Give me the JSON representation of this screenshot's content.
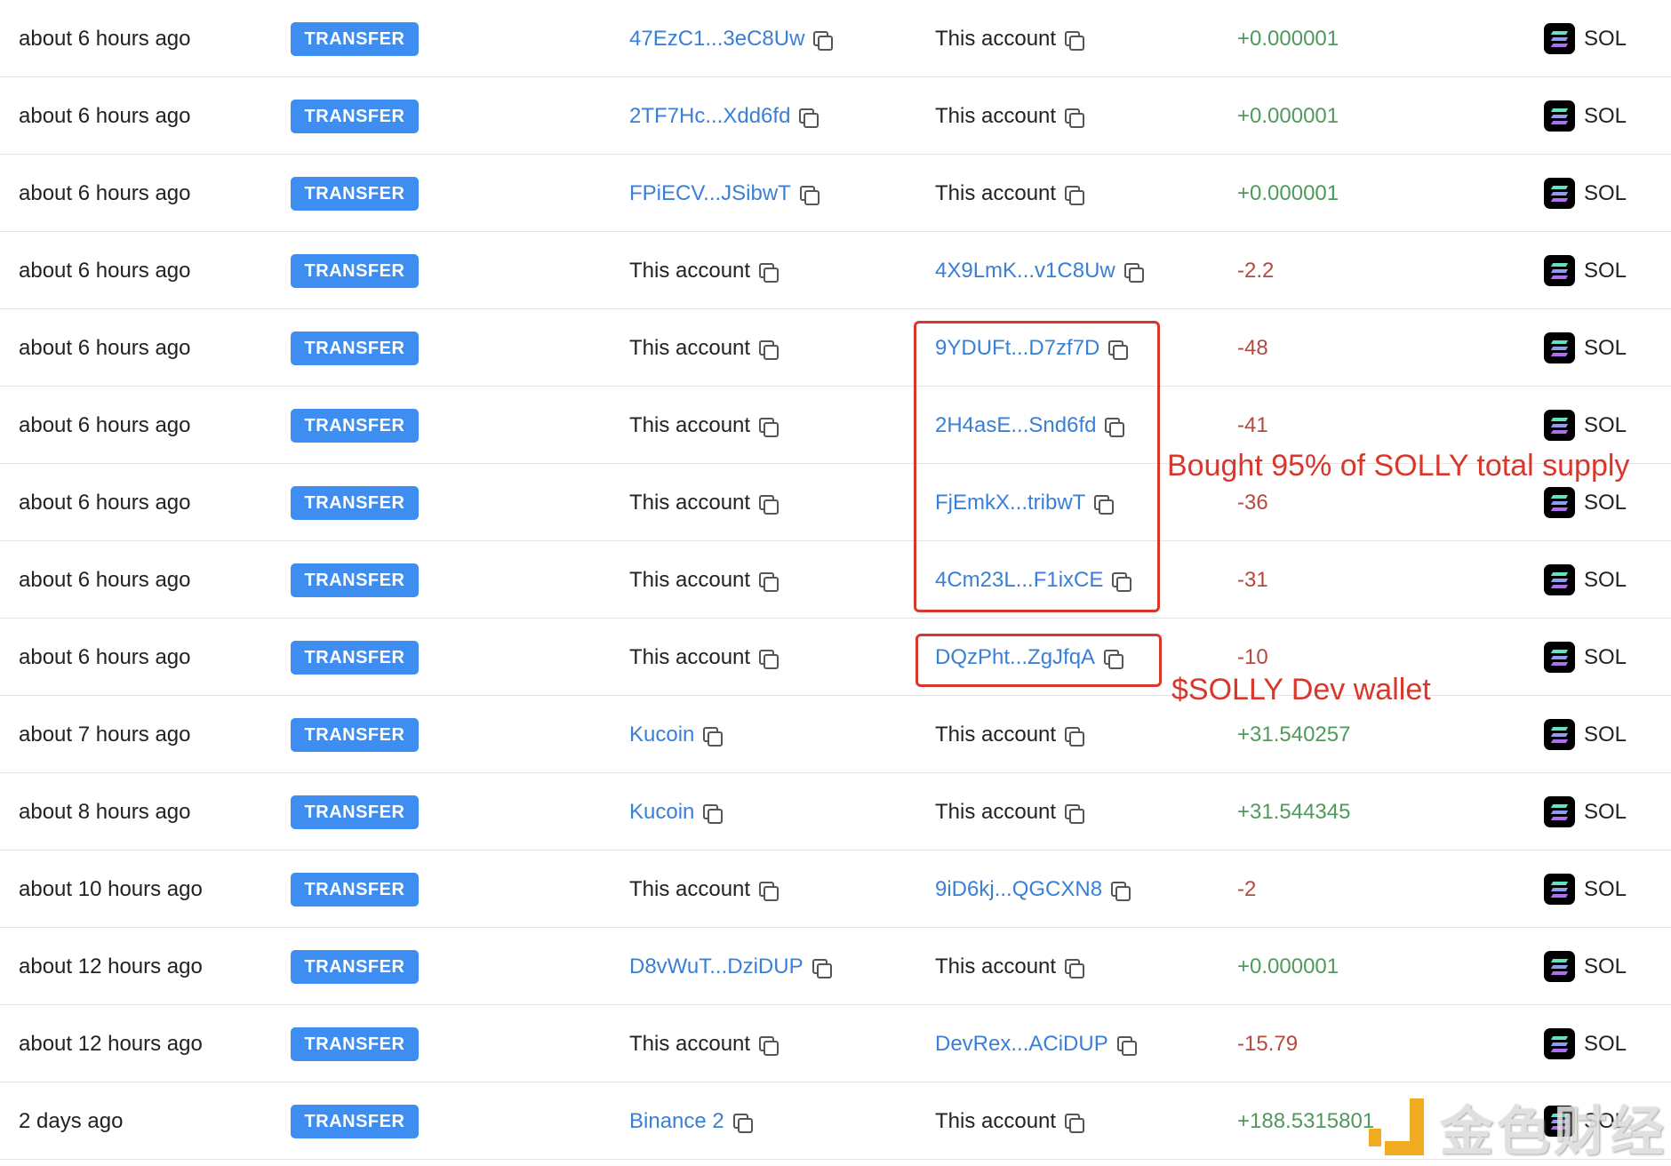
{
  "colors": {
    "badge": "#3d8ef0",
    "link": "#3a7fd6",
    "positive": "#4f9a5b",
    "negative": "#b5483f",
    "annotation": "#d9372b"
  },
  "rows": [
    {
      "time": "about 6 hours ago",
      "type": "TRANSFER",
      "from": "47EzC1...3eC8Uw",
      "from_link": true,
      "to": "This account",
      "to_link": false,
      "amount": "+0.000001",
      "sign": "pos",
      "token": "SOL"
    },
    {
      "time": "about 6 hours ago",
      "type": "TRANSFER",
      "from": "2TF7Hc...Xdd6fd",
      "from_link": true,
      "to": "This account",
      "to_link": false,
      "amount": "+0.000001",
      "sign": "pos",
      "token": "SOL"
    },
    {
      "time": "about 6 hours ago",
      "type": "TRANSFER",
      "from": "FPiECV...JSibwT",
      "from_link": true,
      "to": "This account",
      "to_link": false,
      "amount": "+0.000001",
      "sign": "pos",
      "token": "SOL"
    },
    {
      "time": "about 6 hours ago",
      "type": "TRANSFER",
      "from": "This account",
      "from_link": false,
      "to": "4X9LmK...v1C8Uw",
      "to_link": true,
      "amount": "-2.2",
      "sign": "neg",
      "token": "SOL"
    },
    {
      "time": "about 6 hours ago",
      "type": "TRANSFER",
      "from": "This account",
      "from_link": false,
      "to": "9YDUFt...D7zf7D",
      "to_link": true,
      "amount": "-48",
      "sign": "neg",
      "token": "SOL"
    },
    {
      "time": "about 6 hours ago",
      "type": "TRANSFER",
      "from": "This account",
      "from_link": false,
      "to": "2H4asE...Snd6fd",
      "to_link": true,
      "amount": "-41",
      "sign": "neg",
      "token": "SOL"
    },
    {
      "time": "about 6 hours ago",
      "type": "TRANSFER",
      "from": "This account",
      "from_link": false,
      "to": "FjEmkX...tribwT",
      "to_link": true,
      "amount": "-36",
      "sign": "neg",
      "token": "SOL"
    },
    {
      "time": "about 6 hours ago",
      "type": "TRANSFER",
      "from": "This account",
      "from_link": false,
      "to": "4Cm23L...F1ixCE",
      "to_link": true,
      "amount": "-31",
      "sign": "neg",
      "token": "SOL"
    },
    {
      "time": "about 6 hours ago",
      "type": "TRANSFER",
      "from": "This account",
      "from_link": false,
      "to": "DQzPht...ZgJfqA",
      "to_link": true,
      "amount": "-10",
      "sign": "neg",
      "token": "SOL"
    },
    {
      "time": "about 7 hours ago",
      "type": "TRANSFER",
      "from": "Kucoin",
      "from_link": true,
      "to": "This account",
      "to_link": false,
      "amount": "+31.540257",
      "sign": "pos",
      "token": "SOL"
    },
    {
      "time": "about 8 hours ago",
      "type": "TRANSFER",
      "from": "Kucoin",
      "from_link": true,
      "to": "This account",
      "to_link": false,
      "amount": "+31.544345",
      "sign": "pos",
      "token": "SOL"
    },
    {
      "time": "about 10 hours ago",
      "type": "TRANSFER",
      "from": "This account",
      "from_link": false,
      "to": "9iD6kj...QGCXN8",
      "to_link": true,
      "amount": "-2",
      "sign": "neg",
      "token": "SOL"
    },
    {
      "time": "about 12 hours ago",
      "type": "TRANSFER",
      "from": "D8vWuT...DziDUP",
      "from_link": true,
      "to": "This account",
      "to_link": false,
      "amount": "+0.000001",
      "sign": "pos",
      "token": "SOL"
    },
    {
      "time": "about 12 hours ago",
      "type": "TRANSFER",
      "from": "This account",
      "from_link": false,
      "to": "DevRex...ACiDUP",
      "to_link": true,
      "amount": "-15.79",
      "sign": "neg",
      "token": "SOL"
    },
    {
      "time": "2 days ago",
      "type": "TRANSFER",
      "from": "Binance 2",
      "from_link": true,
      "to": "This account",
      "to_link": false,
      "amount": "+188.5315801",
      "sign": "pos",
      "token": "SOL"
    }
  ],
  "annotations": {
    "bought": "Bought 95% of SOLLY total supply",
    "dev_wallet": "$SOLLY Dev wallet"
  },
  "watermark": {
    "text": "金色财经"
  }
}
